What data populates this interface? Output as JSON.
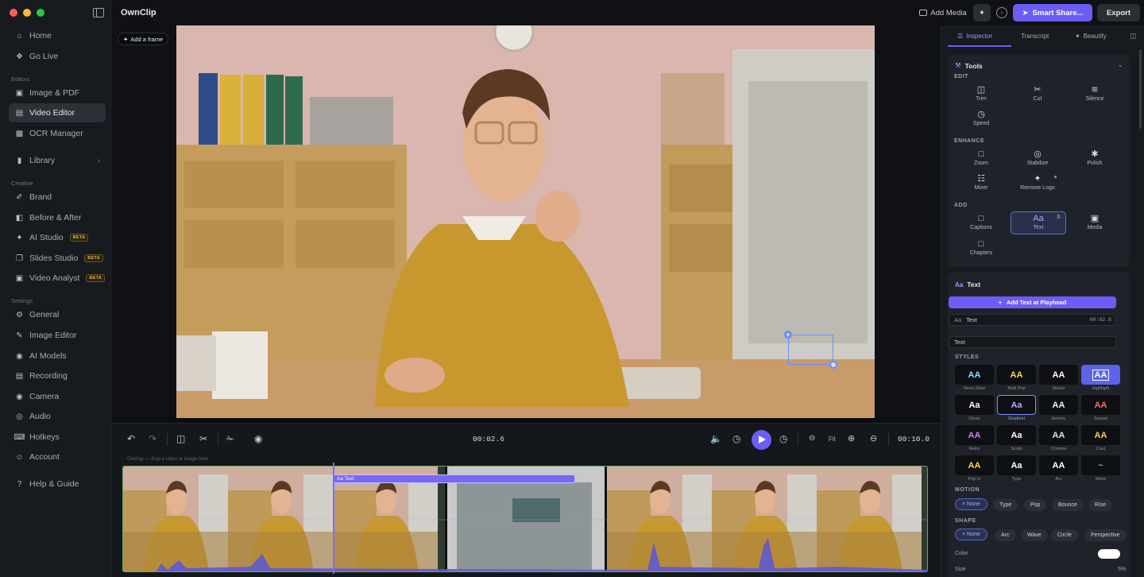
{
  "app": {
    "title": "OwnClip"
  },
  "window": {
    "traffic_colors": [
      "#ff5f57",
      "#febc2e",
      "#28c840"
    ]
  },
  "sidebar": {
    "items": [
      {
        "label": "Home",
        "icon": "home-icon"
      },
      {
        "label": "Go Live",
        "icon": "broadcast-icon"
      }
    ],
    "sections": [
      {
        "title": "Editors",
        "items": [
          {
            "label": "Image & PDF",
            "icon": "image-pdf-icon"
          },
          {
            "label": "Video Editor",
            "icon": "video-editor-icon",
            "active": true
          },
          {
            "label": "OCR Manager",
            "icon": "ocr-icon"
          }
        ]
      },
      {
        "title": "",
        "items": [
          {
            "label": "Library",
            "icon": "folder-icon"
          }
        ]
      },
      {
        "title": "Creative",
        "items": [
          {
            "label": "Brand",
            "icon": "brush-icon"
          },
          {
            "label": "Before & After",
            "icon": "split-icon"
          },
          {
            "label": "AI Studio",
            "icon": "sparkle-icon",
            "badge": "BETA"
          },
          {
            "label": "Slides Studio",
            "icon": "slides-icon",
            "badge": "BETA"
          },
          {
            "label": "Video Analyst",
            "icon": "analyst-icon",
            "badge": "BETA"
          }
        ]
      },
      {
        "title": "Settings",
        "items": [
          {
            "label": "General",
            "icon": "gear-icon"
          },
          {
            "label": "Image Editor",
            "icon": "image-editor-icon"
          },
          {
            "label": "AI Models",
            "icon": "ai-models-icon"
          },
          {
            "label": "Recording",
            "icon": "recording-icon"
          },
          {
            "label": "Camera",
            "icon": "camera-icon"
          },
          {
            "label": "Audio",
            "icon": "audio-icon"
          },
          {
            "label": "Hotkeys",
            "icon": "keyboard-icon"
          },
          {
            "label": "Account",
            "icon": "account-icon"
          }
        ]
      },
      {
        "title": "",
        "items": [
          {
            "label": "Help & Guide",
            "icon": "help-icon"
          }
        ]
      }
    ]
  },
  "topbar": {
    "add_media": "Add Media",
    "smart_share": "Smart Share...",
    "export": "Export"
  },
  "canvas": {
    "add_frame": "Add a frame",
    "overlay_text": "Text"
  },
  "transport": {
    "current_time": "00:02.6",
    "duration": "00:10.0",
    "fit_label": "Fit"
  },
  "timeline": {
    "hint": "Overlay — drop a video or image here",
    "text_clip_label": "Aa Text",
    "playhead_fraction": 0.26
  },
  "panel": {
    "tabs": [
      {
        "label": "Inspector",
        "icon": "sliders-icon",
        "active": true
      },
      {
        "label": "Transcript",
        "icon": "transcript-icon"
      },
      {
        "label": "Beautify",
        "icon": "wand-icon"
      }
    ],
    "tools": {
      "title": "Tools",
      "groups": [
        {
          "label": "EDIT",
          "items": [
            {
              "label": "Trim",
              "icon": "trim-icon"
            },
            {
              "label": "Cut",
              "icon": "scissors-icon"
            },
            {
              "label": "Silence",
              "icon": "silence-icon"
            },
            {
              "label": "Speed",
              "icon": "speed-icon"
            }
          ]
        },
        {
          "label": "ENHANCE",
          "items": [
            {
              "label": "Zoom",
              "icon": "zoom-icon"
            },
            {
              "label": "Stabilize",
              "icon": "stabilize-icon"
            },
            {
              "label": "Polish",
              "icon": "polish-icon"
            },
            {
              "label": "Mixer",
              "icon": "mixer-icon"
            },
            {
              "label": "Remove Logo",
              "icon": "remove-logo-icon"
            }
          ]
        },
        {
          "label": "ADD",
          "items": [
            {
              "label": "Captions",
              "icon": "captions-icon"
            },
            {
              "label": "Text",
              "icon": "text-icon",
              "selected": true,
              "badge": "1"
            },
            {
              "label": "Media",
              "icon": "media-icon"
            },
            {
              "label": "Chapters",
              "icon": "chapters-icon"
            }
          ]
        }
      ]
    },
    "text": {
      "title": "Text",
      "add_button": "Add Text at Playhead",
      "layer_name": "Text",
      "layer_time": "00:02.6",
      "input_value": "Text",
      "styles_label": "STYLES",
      "styles": [
        {
          "name": "Neon Glow",
          "glyph": "AA",
          "color": "#7fe3ff"
        },
        {
          "name": "Bold Pop",
          "glyph": "AA",
          "color": "#ffd54a"
        },
        {
          "name": "Sticker",
          "glyph": "AA",
          "color": "#ffffff"
        },
        {
          "name": "Highlight",
          "glyph": "AA",
          "color": "#ffffff",
          "bg": "#5b63e8"
        },
        {
          "name": "Clean",
          "glyph": "Aa",
          "color": "#ffffff"
        },
        {
          "name": "Gradient",
          "glyph": "Aa",
          "color": "#b9a6ff",
          "selected": true
        },
        {
          "name": "Electric",
          "glyph": "AA",
          "color": "#e8f4ff"
        },
        {
          "name": "Sunset",
          "glyph": "AA",
          "color": "#ff6a5a"
        },
        {
          "name": "Retro",
          "glyph": "AA",
          "color": "#d07cff"
        },
        {
          "name": "Script",
          "glyph": "Aa",
          "color": "#ffffff"
        },
        {
          "name": "Chrome",
          "glyph": "AA",
          "color": "#dfe3e8"
        },
        {
          "name": "Cast",
          "glyph": "AA",
          "color": "#ffcf3a"
        },
        {
          "name": "Pop In",
          "glyph": "AA",
          "color": "#ffd54a"
        },
        {
          "name": "Type",
          "glyph": "Aa",
          "color": "#ffffff"
        },
        {
          "name": "Arc",
          "glyph": "AA",
          "color": "#ffffff"
        },
        {
          "name": "Wave",
          "glyph": "~",
          "color": "#8fa2ff"
        }
      ],
      "motion_label": "MOTION",
      "motion": [
        {
          "label": "None",
          "selected": true
        },
        {
          "label": "Type"
        },
        {
          "label": "Pop"
        },
        {
          "label": "Bounce"
        },
        {
          "label": "Rise"
        }
      ],
      "shape_label": "SHAPE",
      "shape": [
        {
          "label": "None",
          "selected": true
        },
        {
          "label": "Arc"
        },
        {
          "label": "Wave"
        },
        {
          "label": "Circle"
        },
        {
          "label": "Perspective"
        }
      ],
      "color_label": "Color",
      "color_value": "#ffffff",
      "size_label": "Size",
      "size_value": "5%"
    }
  },
  "accent": "#6b5df6"
}
